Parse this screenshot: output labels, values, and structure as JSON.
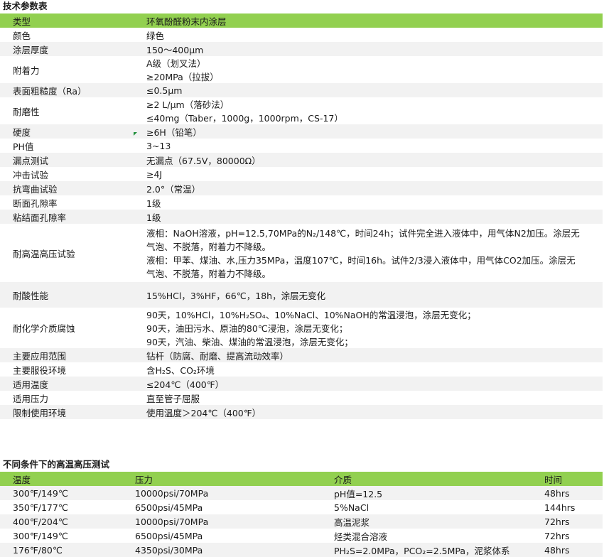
{
  "section1_title": "技术参数表",
  "spec_table": {
    "header": {
      "label": "类型",
      "value": "环氧酚醛粉末内涂层"
    },
    "rows": [
      {
        "label": "颜色",
        "lines": [
          "绿色"
        ]
      },
      {
        "label": "涂层厚度",
        "lines": [
          "150～400μm"
        ]
      },
      {
        "label": "附着力",
        "lines": [
          "A级（划叉法）",
          "≥20MPa（拉拔）"
        ]
      },
      {
        "label": "表面粗糙度（Ra）",
        "lines": [
          "≤0.5μm"
        ]
      },
      {
        "label": "耐磨性",
        "lines": [
          "≥2 L/μm（落砂法）",
          "≤40mg（Taber，1000g，1000rpm，CS-17）"
        ]
      },
      {
        "label": "硬度",
        "lines": [
          "≥6H（铅笔）"
        ]
      },
      {
        "label": "PH值",
        "lines": [
          "3~13"
        ]
      },
      {
        "label": "漏点测试",
        "lines": [
          "无漏点（67.5V，80000Ω）"
        ]
      },
      {
        "label": "冲击试验",
        "lines": [
          "≥4J"
        ]
      },
      {
        "label": "抗弯曲试验",
        "lines": [
          "2.0°（常温）"
        ]
      },
      {
        "label": "断面孔隙率",
        "lines": [
          "1级"
        ]
      },
      {
        "label": "粘结面孔隙率",
        "lines": [
          "1级"
        ]
      },
      {
        "label": "耐高温高压试验",
        "lines": [
          "液相：NaOH溶液，pH=12.5,70MPa的N₂/148℃，时间24h；试件完全进入液体中，用气体N2加压。涂层无",
          "气泡、不脱落，附着力不降级。",
          "液相：甲苯、煤油、水,压力35MPa，温度107℃，时间16h。试件2/3浸入液体中，用气体CO2加压。涂层无",
          "气泡、不脱落，附着力不降级。"
        ]
      },
      {
        "label": "耐酸性能",
        "lines": [
          "15%HCl，3%HF，66℃，18h，涂层无变化"
        ]
      },
      {
        "label": "耐化学介质腐蚀",
        "lines": [
          "90天，10%HCl，10%H₂SO₄、10%NaCl、10%NaOH的常温浸泡，涂层无变化；",
          "90天，油田污水、原油的80℃浸泡，涂层无变化；",
          "90天，汽油、柴油、煤油的常温浸泡，涂层无变化；"
        ]
      },
      {
        "label": "主要应用范围",
        "lines": [
          "钻杆（防腐、耐磨、提高流动效率）"
        ]
      },
      {
        "label": "主要服役环境",
        "lines": [
          "含H₂S、CO₂环境"
        ]
      },
      {
        "label": "适用温度",
        "lines": [
          "≤204℃（400℉）"
        ]
      },
      {
        "label": "适用压力",
        "lines": [
          "直至管子屈服"
        ]
      },
      {
        "label": "限制使用环境",
        "lines": [
          "使用温度＞204℃（400℉）"
        ]
      }
    ]
  },
  "section2_title": "不同条件下的高温高压测试",
  "test_table": {
    "headers": [
      "温度",
      "压力",
      "介质",
      "时间"
    ],
    "rows": [
      [
        "300℉/149℃",
        "10000psi/70MPa",
        "pH值=12.5",
        "48hrs"
      ],
      [
        "350℉/177℃",
        "6500psi/45MPa",
        "5%NaCl",
        "144hrs"
      ],
      [
        "400℉/204℃",
        "10000psi/70MPa",
        "高温泥浆",
        "72hrs"
      ],
      [
        "300℉/149℃",
        "6500psi/45MPa",
        "烃类混合溶液",
        "72hrs"
      ],
      [
        "176℉/80℃",
        "4350psi/30MPa",
        "PH₂S=2.0MPa，PCO₂=2.5MPa，泥浆体系",
        "48hrs"
      ]
    ]
  }
}
